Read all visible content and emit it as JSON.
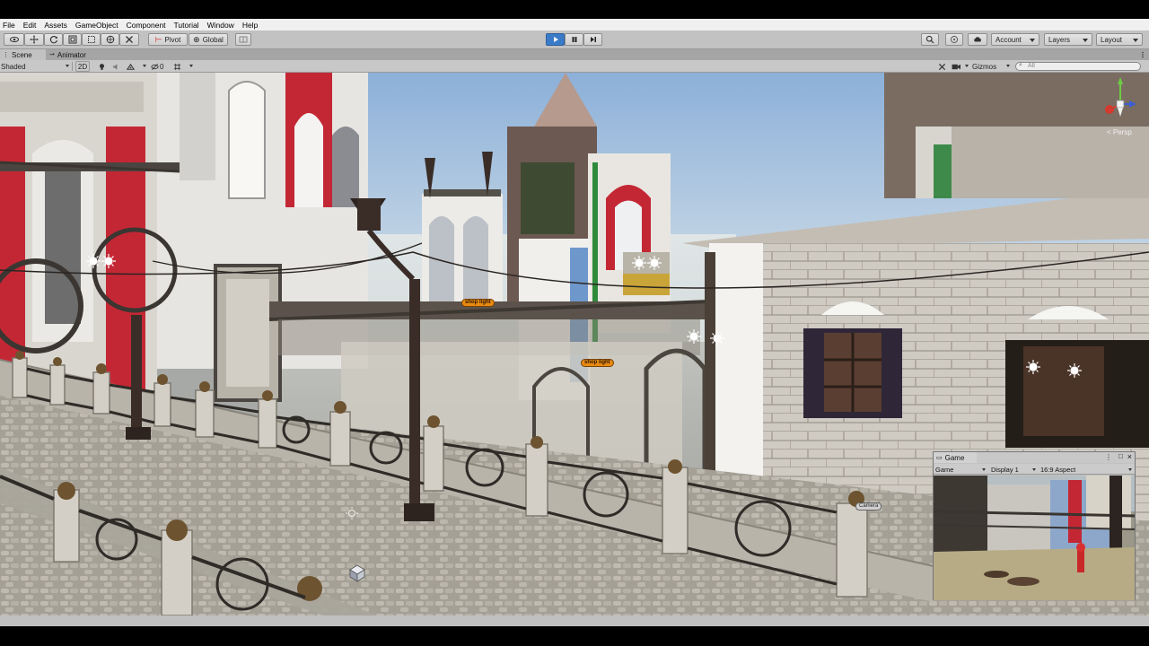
{
  "menu": {
    "items": [
      "File",
      "Edit",
      "Assets",
      "GameObject",
      "Component",
      "Tutorial",
      "Window",
      "Help"
    ]
  },
  "toolbar": {
    "pivot_label": "Pivot",
    "global_label": "Global",
    "account_label": "Account",
    "layers_label": "Layers",
    "layout_label": "Layout"
  },
  "tabs": {
    "scene_label": "Scene",
    "animator_label": "Animator"
  },
  "scene_toolbar": {
    "shading_mode": "Shaded",
    "mode_2d": "2D",
    "fx_count": "0",
    "gizmos_label": "Gizmos",
    "search_placeholder": "All"
  },
  "scene": {
    "persp_label": "< Persp",
    "tags": {
      "shop_light_1": "shop light",
      "shop_light_2": "shop light",
      "camera": "Camera"
    }
  },
  "game_window": {
    "tab_label": "Game",
    "display_mode": "Game",
    "display": "Display 1",
    "aspect": "16:9 Aspect"
  },
  "colors": {
    "play_active": "#3a7bc8",
    "tag_orange": "#e88a12",
    "sky": "#bcd3e8",
    "red_facade": "#c42734"
  }
}
